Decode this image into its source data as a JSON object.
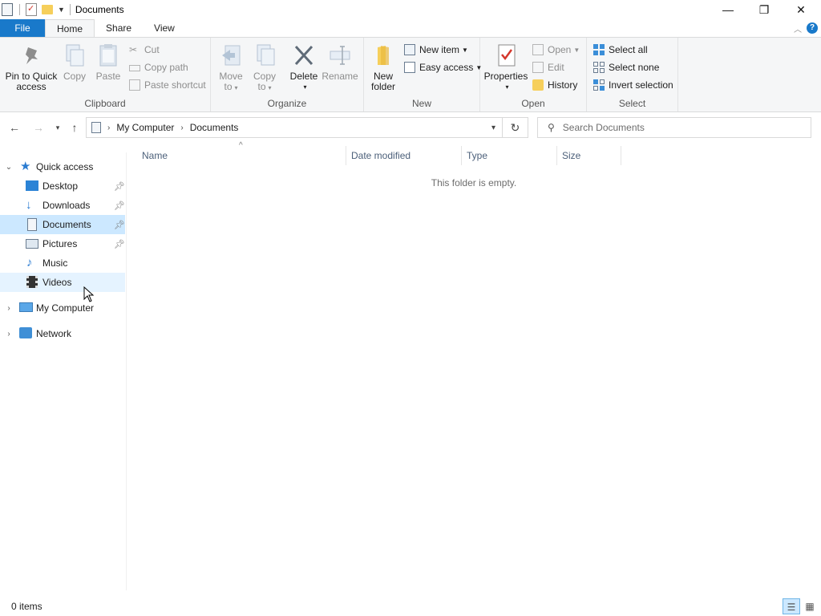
{
  "window": {
    "title": "Documents",
    "minimize_glyph": "—",
    "restore_glyph": "❐",
    "close_glyph": "✕"
  },
  "ribbon_tabs": [
    {
      "label": "File"
    },
    {
      "label": "Home"
    },
    {
      "label": "Share"
    },
    {
      "label": "View"
    }
  ],
  "ribbon": {
    "clipboard": {
      "label": "Clipboard",
      "pin_label_1": "Pin to Quick",
      "pin_label_2": "access",
      "copy": "Copy",
      "paste": "Paste",
      "cut": "Cut",
      "copy_path": "Copy path",
      "paste_shortcut": "Paste shortcut"
    },
    "organize": {
      "label": "Organize",
      "move_to_1": "Move",
      "move_to_2": "to",
      "copy_to_1": "Copy",
      "copy_to_2": "to",
      "delete": "Delete",
      "rename": "Rename"
    },
    "new": {
      "label": "New",
      "new_folder_1": "New",
      "new_folder_2": "folder",
      "new_item": "New item",
      "easy_access": "Easy access"
    },
    "open": {
      "label": "Open",
      "properties": "Properties",
      "open": "Open",
      "edit": "Edit",
      "history": "History"
    },
    "select": {
      "label": "Select",
      "select_all": "Select all",
      "select_none": "Select none",
      "invert": "Invert selection"
    }
  },
  "address": {
    "crumbs": [
      "My Computer",
      "Documents"
    ]
  },
  "search": {
    "placeholder": "Search Documents"
  },
  "nav_pane": {
    "quick_access": "Quick access",
    "items": [
      {
        "label": "Desktop",
        "pinned": true
      },
      {
        "label": "Downloads",
        "pinned": true
      },
      {
        "label": "Documents",
        "pinned": true,
        "selected": true
      },
      {
        "label": "Pictures",
        "pinned": true
      },
      {
        "label": "Music",
        "pinned": false
      },
      {
        "label": "Videos",
        "pinned": false,
        "hover": true
      }
    ],
    "my_computer": "My Computer",
    "network": "Network"
  },
  "columns": [
    "Name",
    "Date modified",
    "Type",
    "Size"
  ],
  "empty_message": "This folder is empty.",
  "status": {
    "count": "0 items"
  },
  "colors": {
    "accent": "#1979ca",
    "selected": "#cce8ff",
    "hover": "#e5f3ff",
    "folder": "#f6cf5b"
  }
}
